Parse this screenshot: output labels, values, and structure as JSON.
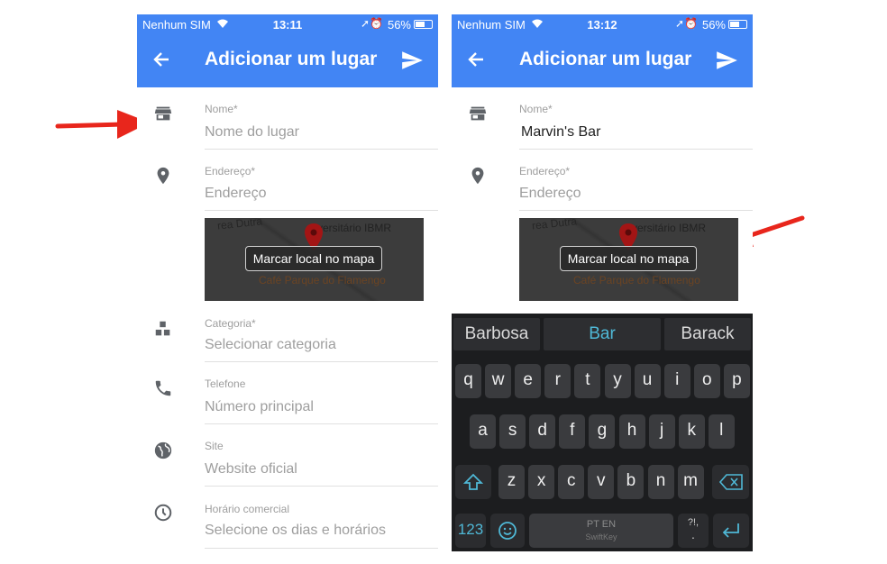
{
  "status": {
    "left": {
      "carrier": "Nenhum SIM",
      "time": "13:11",
      "battery": "56%"
    },
    "right": {
      "carrier": "Nenhum SIM",
      "time": "13:12",
      "battery": "56%"
    }
  },
  "app_bar": {
    "title": "Adicionar um lugar"
  },
  "fields": {
    "name_label": "Nome*",
    "name_placeholder": "Nome do lugar",
    "name_value_right": "Marvin's Bar",
    "address_label": "Endereço*",
    "address_placeholder": "Endereço",
    "category_label": "Categoria*",
    "category_placeholder": "Selecionar categoria",
    "phone_label": "Telefone",
    "phone_placeholder": "Número principal",
    "site_label": "Site",
    "site_placeholder": "Website oficial",
    "hours_label": "Horário comercial",
    "hours_placeholder": "Selecione os dias e horários"
  },
  "map": {
    "button_label": "Marcar local no mapa",
    "road_text": "rea Dutra",
    "poi_text": "versitário IBMR",
    "cafe_text": "Café Parque do Flamengo"
  },
  "keyboard": {
    "suggestions": [
      "Barbosa",
      "Bar",
      "Barack"
    ],
    "row1": [
      "q",
      "w",
      "e",
      "r",
      "t",
      "y",
      "u",
      "i",
      "o",
      "p"
    ],
    "row2": [
      "a",
      "s",
      "d",
      "f",
      "g",
      "h",
      "j",
      "k",
      "l"
    ],
    "row3": [
      "z",
      "x",
      "c",
      "v",
      "b",
      "n",
      "m"
    ],
    "numbers_key": "123",
    "space_lang": "PT EN",
    "space_brand": "SwiftKey",
    "punct_top": "?!,",
    "punct_bottom": "."
  },
  "colors": {
    "app_bar": "#4285f4",
    "annotation_arrow": "#e8261c",
    "keyboard_accent": "#4fb8d6"
  },
  "icons": [
    "back-arrow-icon",
    "send-icon",
    "store-icon",
    "location-pin-icon",
    "category-icon",
    "phone-icon",
    "globe-icon",
    "clock-icon",
    "shift-icon",
    "backspace-icon",
    "emoji-icon",
    "enter-icon"
  ]
}
